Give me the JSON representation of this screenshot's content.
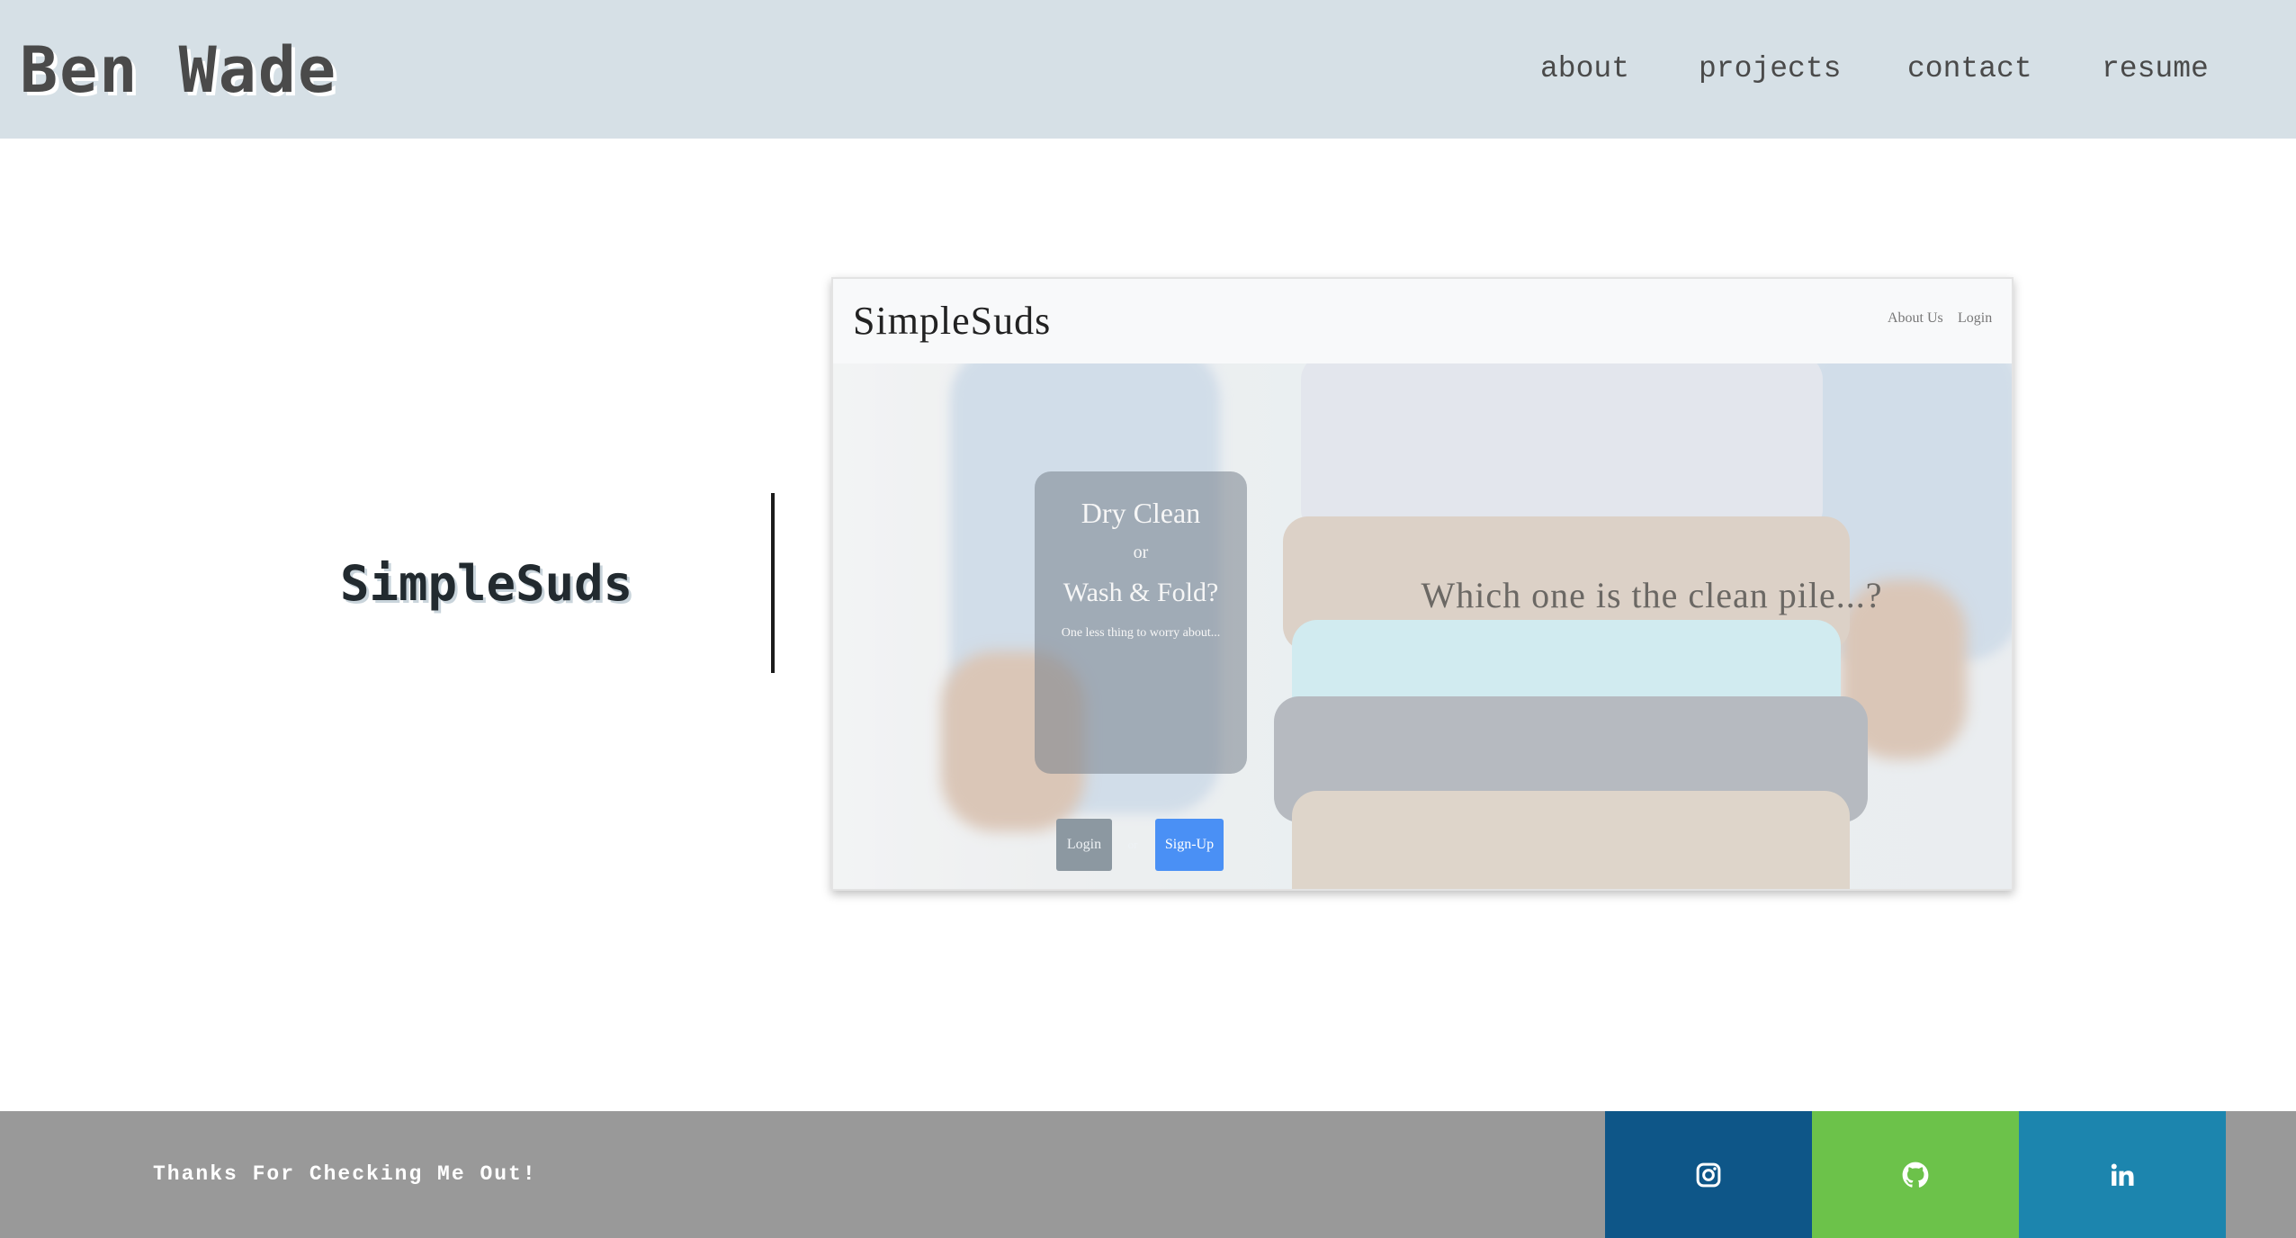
{
  "header": {
    "brand": "Ben Wade",
    "nav": [
      "about",
      "projects",
      "contact",
      "resume"
    ]
  },
  "project": {
    "title": "SimpleSuds",
    "screenshot": {
      "logo": "SimpleSuds",
      "nav_links": [
        "About Us",
        "Login"
      ],
      "card": {
        "line1": "Dry Clean",
        "line2": "or",
        "line3": "Wash & Fold?",
        "tagline": "One less thing to worry about...",
        "login_label": "Login",
        "or_label": "or",
        "signup_label": "Sign-Up"
      },
      "caption": "Which one is the clean pile...?"
    }
  },
  "footer": {
    "message": "Thanks For Checking Me Out!",
    "social": [
      {
        "name": "instagram-icon",
        "color": "#0e5688"
      },
      {
        "name": "github-icon",
        "color": "#6cc24a"
      },
      {
        "name": "linkedin-icon",
        "color": "#1c85ae"
      }
    ]
  },
  "colors": {
    "header_bg": "#d6e0e6",
    "footer_bg": "#999999",
    "signup_button": "#4a90f5"
  }
}
